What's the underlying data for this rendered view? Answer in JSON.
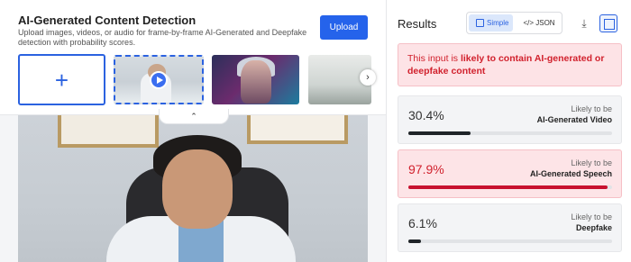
{
  "header": {
    "title": "AI-Generated Content Detection",
    "subtitle": "Upload images, videos, or audio for frame-by-frame AI-Generated and Deepfake detection with probability scores.",
    "upload_label": "Upload"
  },
  "thumbnails": {
    "add_label": "+",
    "items": [
      {
        "name": "doctor-video",
        "selected": true,
        "icon": "play-icon"
      },
      {
        "name": "cyber-woman-image",
        "selected": false
      },
      {
        "name": "office-room-image",
        "selected": false
      }
    ],
    "next_icon": "chevron-right-icon"
  },
  "collapse_icon": "chevron-up-icon",
  "results": {
    "title": "Results",
    "mode_simple": "Simple",
    "mode_json": "</> JSON",
    "download_icon": "download-icon",
    "layout_icon": "layout-icon",
    "verdict_prefix": "This input is ",
    "verdict_highlight": "likely to contain AI-generated or deepfake content",
    "cards": [
      {
        "percent": "30.4%",
        "value": 0.304,
        "caption": "Likely to be",
        "label": "AI-Generated Video",
        "alert": false
      },
      {
        "percent": "97.9%",
        "value": 0.979,
        "caption": "Likely to be",
        "label": "AI-Generated Speech",
        "alert": true
      },
      {
        "percent": "6.1%",
        "value": 0.061,
        "caption": "Likely to be",
        "label": "Deepfake",
        "alert": false
      }
    ]
  },
  "colors": {
    "accent": "#2563eb",
    "alert_text": "#d1212d",
    "alert_bg": "#fde3e6",
    "bar_dark": "#1f2428",
    "bar_red": "#c8102e"
  }
}
